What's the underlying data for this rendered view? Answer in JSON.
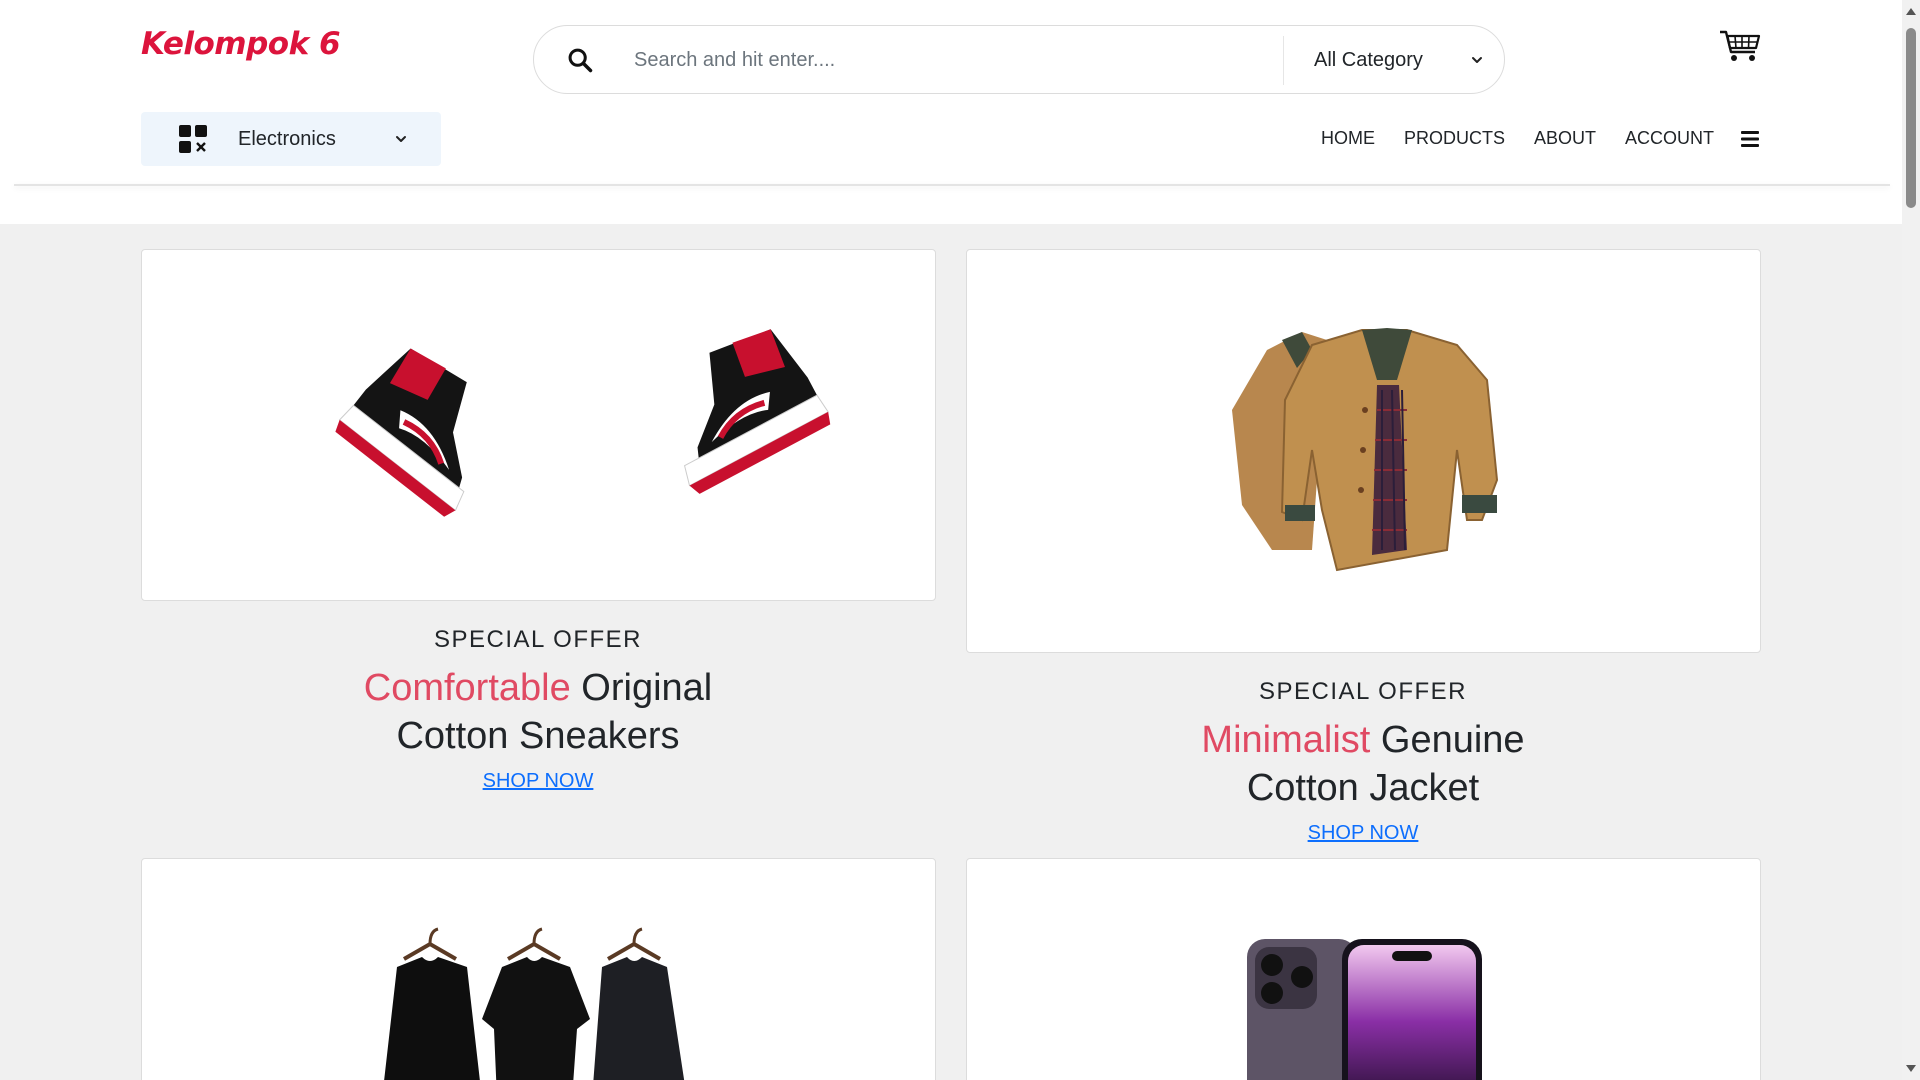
{
  "brand": {
    "logo": "Kelompok 6"
  },
  "search": {
    "placeholder": "Search and hit enter....",
    "category": "All Category"
  },
  "department": {
    "label": "Electronics"
  },
  "nav": {
    "items": [
      "HOME",
      "PRODUCTS",
      "ABOUT",
      "ACCOUNT"
    ]
  },
  "offers": [
    {
      "kicker": "SPECIAL OFFER",
      "highlight": "Comfortable",
      "title_rest": "Original",
      "title_line2": "Cotton Sneakers",
      "cta": "SHOP NOW",
      "image": "sneakers"
    },
    {
      "kicker": "SPECIAL OFFER",
      "highlight": "Minimalist",
      "title_rest": "Genuine",
      "title_line2": "Cotton Jacket",
      "cta": "SHOP NOW",
      "image": "jacket"
    }
  ],
  "more_products": [
    "t-shirts",
    "smartphone"
  ],
  "colors": {
    "brand": "#dc143c",
    "highlight": "#e04a63",
    "link": "#0d6efd",
    "page_bg": "#f0f0f0",
    "dept_bg": "#eef5fc"
  }
}
